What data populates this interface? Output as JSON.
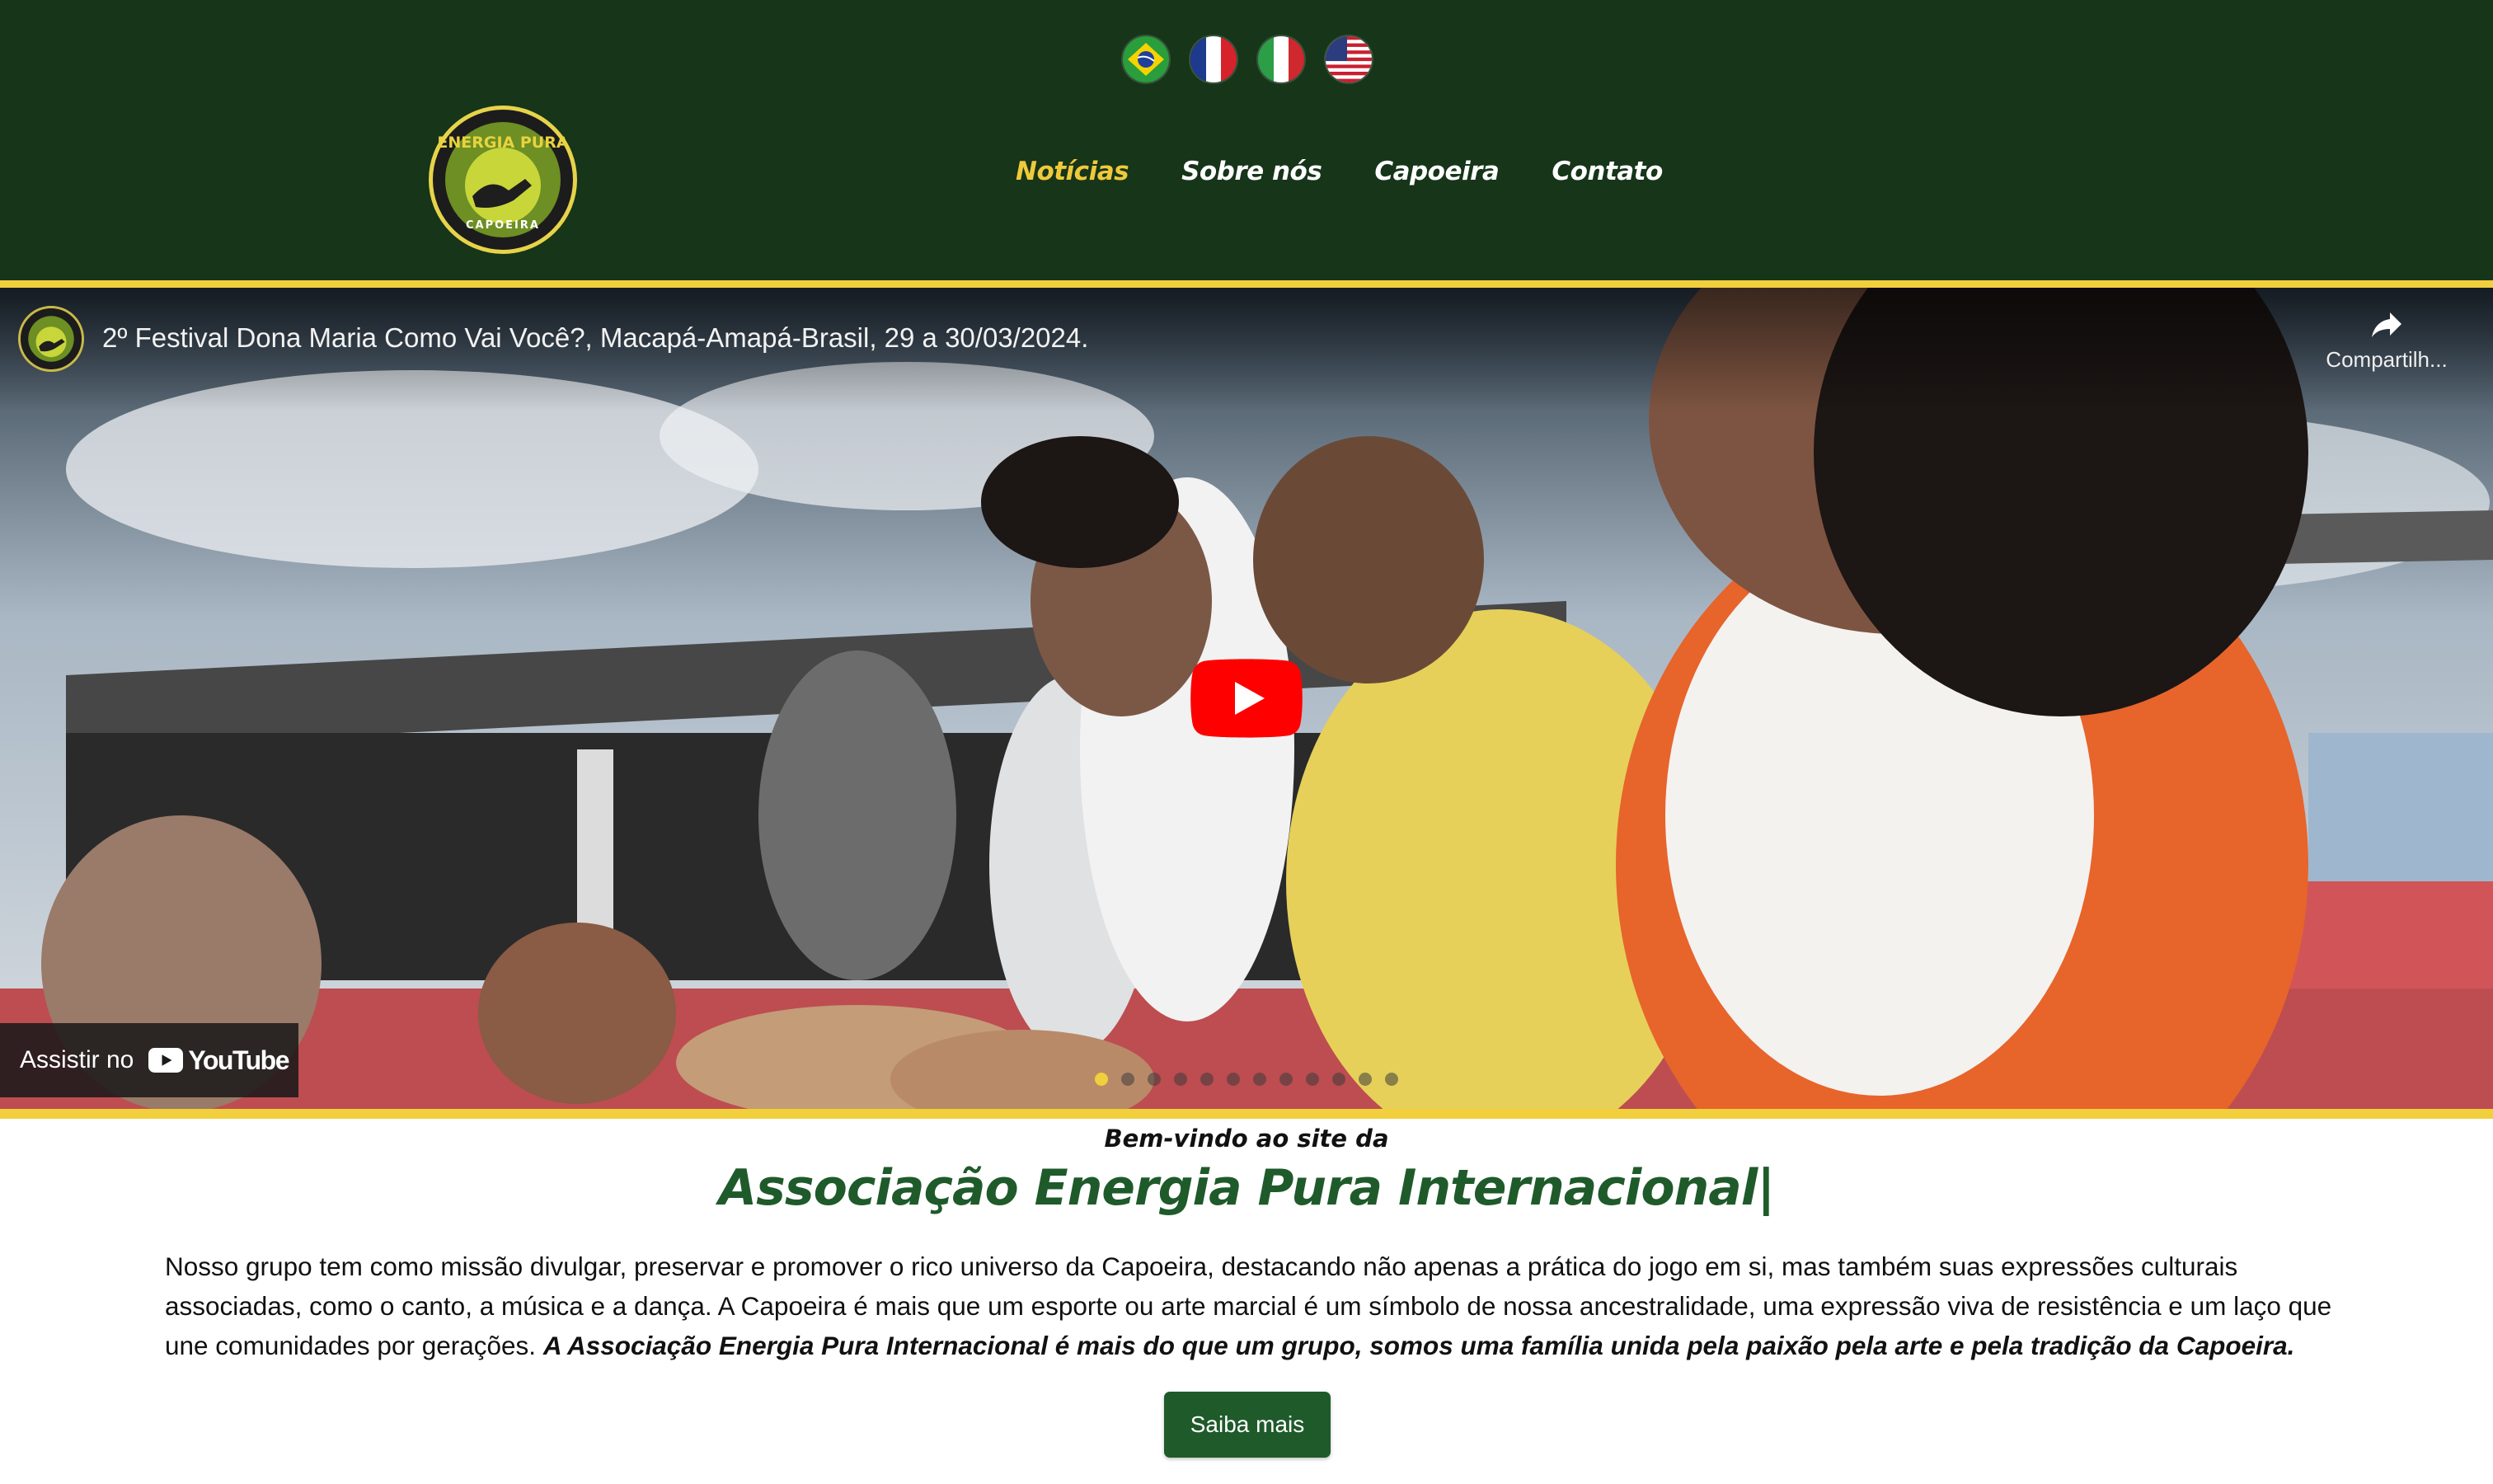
{
  "header": {
    "flags": [
      {
        "name": "brazil-flag-icon"
      },
      {
        "name": "france-flag-icon"
      },
      {
        "name": "italy-flag-icon"
      },
      {
        "name": "usa-flag-icon"
      }
    ],
    "logo": {
      "top_text": "ENERGIA PURA",
      "bottom_text": "CAPOEIRA"
    },
    "nav": [
      {
        "label": "Notícias",
        "active": true
      },
      {
        "label": "Sobre nós",
        "active": false
      },
      {
        "label": "Capoeira",
        "active": false
      },
      {
        "label": "Contato",
        "active": false
      }
    ]
  },
  "video": {
    "title": "2º Festival Dona Maria Como Vai Você?, Macapá-Amapá-Brasil, 29 a 30/03/2024.",
    "share_label": "Compartilh...",
    "watch_on_label": "Assistir no",
    "youtube_word": "YouTube",
    "carousel_dots": 12,
    "active_dot": 0
  },
  "welcome": {
    "pre_title": "Bem-vindo ao site da",
    "title": "Associação Energia Pura Internacional|",
    "intro_text": "Nosso grupo tem como missão divulgar, preservar e promover o rico universo da Capoeira, destacando não apenas a prática do jogo em si, mas também suas expressões culturais associadas, como o canto, a música e a dança. A Capoeira é mais que um esporte ou arte marcial é um símbolo de nossa ancestralidade, uma expressão viva de resistência e um laço que une comunidades por gerações.",
    "intro_emphasis": "A Associação Energia Pura Internacional é mais do que um grupo, somos uma família unida pela paixão pela arte e pela tradição da Capoeira.",
    "button_label": "Saiba mais"
  },
  "colors": {
    "header_bg": "#163519",
    "accent_yellow": "#f1cf3d",
    "nav_active": "#f0c93a",
    "title_green": "#1f5a2b",
    "button_green": "#1f5a2b",
    "youtube_red": "#ff0000"
  }
}
